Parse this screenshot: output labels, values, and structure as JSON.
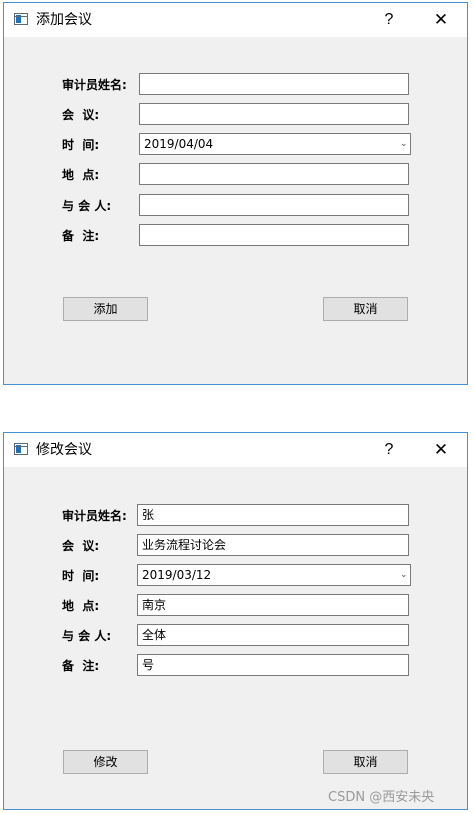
{
  "add_dialog": {
    "title": "添加会议",
    "help_label": "?",
    "close_label": "✕",
    "labels": {
      "auditor": "审计员姓名:",
      "meeting": "会  议:",
      "time": "时  间:",
      "place": "地  点:",
      "participants": "与 会 人:",
      "note": "备  注:"
    },
    "values": {
      "auditor": "",
      "meeting": "",
      "time": "2019/04/04",
      "place": "",
      "participants": "",
      "note": ""
    },
    "primary_button": "添加",
    "cancel_button": "取消"
  },
  "edit_dialog": {
    "title": "修改会议",
    "help_label": "?",
    "close_label": "✕",
    "labels": {
      "auditor": "审计员姓名:",
      "meeting": "会  议:",
      "time": "时  间:",
      "place": "地  点:",
      "participants": "与 会 人:",
      "note": "备  注:"
    },
    "values": {
      "auditor": "张",
      "meeting": "业务流程讨论会",
      "time": "2019/03/12",
      "place": "南京",
      "participants": "全体",
      "note": "号"
    },
    "primary_button": "修改",
    "cancel_button": "取消"
  },
  "icons": {
    "app": "window-app-icon",
    "dropdown": "chevron-down-icon"
  },
  "colors": {
    "window_border": "#4a8fd4",
    "dialog_background": "#f0f0f0",
    "button_background": "#e1e1e1"
  },
  "watermark": "CSDN @西安未央"
}
